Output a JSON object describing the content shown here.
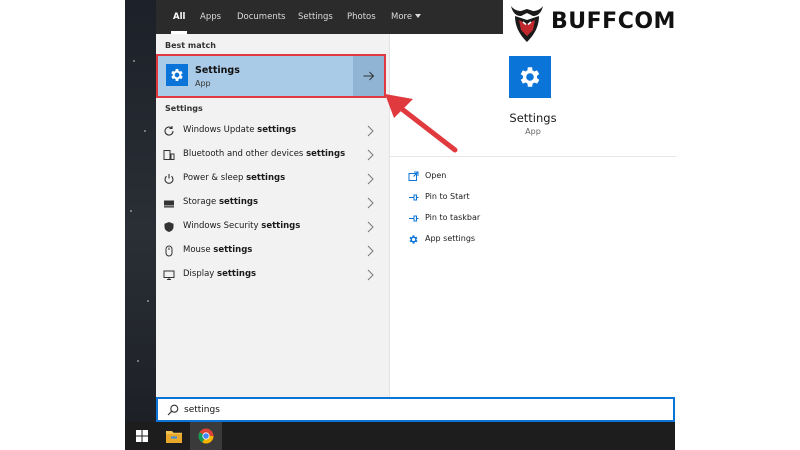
{
  "tabs": [
    {
      "label": "All",
      "active": true
    },
    {
      "label": "Apps"
    },
    {
      "label": "Documents"
    },
    {
      "label": "Settings"
    },
    {
      "label": "Photos"
    },
    {
      "label": "More"
    }
  ],
  "best_match": {
    "section_label": "Best match",
    "title": "Settings",
    "subtitle": "App",
    "icon": "gear-icon"
  },
  "settings_section": {
    "label": "Settings",
    "items": [
      {
        "prefix": "Windows Update ",
        "bold": "settings",
        "icon": "refresh-icon"
      },
      {
        "prefix": "Bluetooth and other devices ",
        "bold": "settings",
        "icon": "devices-icon"
      },
      {
        "prefix": "Power & sleep ",
        "bold": "settings",
        "icon": "power-icon"
      },
      {
        "prefix": "Storage ",
        "bold": "settings",
        "icon": "storage-icon"
      },
      {
        "prefix": "Windows Security ",
        "bold": "settings",
        "icon": "shield-icon"
      },
      {
        "prefix": "Mouse ",
        "bold": "settings",
        "icon": "mouse-icon"
      },
      {
        "prefix": "Display ",
        "bold": "settings",
        "icon": "display-icon"
      }
    ]
  },
  "detail": {
    "app_name": "Settings",
    "app_type": "App",
    "actions": [
      {
        "label": "Open",
        "icon": "open-icon"
      },
      {
        "label": "Pin to Start",
        "icon": "pin-icon"
      },
      {
        "label": "Pin to taskbar",
        "icon": "pin-icon"
      },
      {
        "label": "App settings",
        "icon": "gear-icon"
      }
    ]
  },
  "search": {
    "value": "settings"
  },
  "logo": {
    "text": "BUFFCOM"
  },
  "colors": {
    "accent": "#0a74d8",
    "highlight": "#a9cbe8",
    "callout_red": "#e03a3f",
    "tab_bar": "#2b2b2b",
    "taskbar": "#1d1d1d"
  }
}
